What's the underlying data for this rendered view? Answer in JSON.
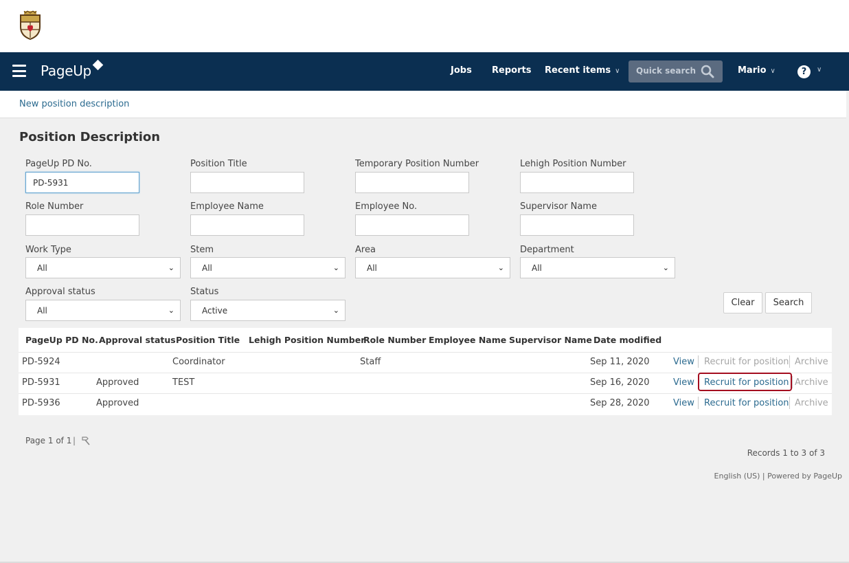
{
  "header": {
    "brand": "PageUp",
    "nav": {
      "jobs": "Jobs",
      "reports": "Reports",
      "recent_items": "Recent items",
      "quick_search_placeholder": "Quick search",
      "user": "Mario",
      "help": "?"
    }
  },
  "subnav": {
    "new_link": "New position description"
  },
  "page_title": "Position Description",
  "search_form": {
    "pd_no": {
      "label": "PageUp PD No.",
      "value": "PD-5931"
    },
    "position_title": {
      "label": "Position Title",
      "value": ""
    },
    "temp_position_number": {
      "label": "Temporary Position Number",
      "value": ""
    },
    "lehigh_position_number": {
      "label": "Lehigh Position Number",
      "value": ""
    },
    "role_number": {
      "label": "Role Number",
      "value": ""
    },
    "employee_name": {
      "label": "Employee Name",
      "value": ""
    },
    "employee_no": {
      "label": "Employee No.",
      "value": ""
    },
    "supervisor_name": {
      "label": "Supervisor Name",
      "value": ""
    },
    "work_type": {
      "label": "Work Type",
      "value": "All"
    },
    "stem": {
      "label": "Stem",
      "value": "All"
    },
    "area": {
      "label": "Area",
      "value": "All"
    },
    "department": {
      "label": "Department",
      "value": "All"
    },
    "approval_status": {
      "label": "Approval status",
      "value": "All"
    },
    "status": {
      "label": "Status",
      "value": "Active"
    },
    "clear_label": "Clear",
    "search_label": "Search"
  },
  "table": {
    "columns": [
      "PageUp PD No.",
      "Approval status",
      "Position Title",
      "Lehigh Position Number",
      "Role Number",
      "Employee Name",
      "Supervisor Name",
      "Date modified"
    ],
    "actions": {
      "view": "View",
      "recruit": "Recruit for position",
      "archive": "Archive"
    },
    "rows": [
      {
        "pd_no": "PD-5924",
        "approval": "",
        "title": "Coordinator",
        "lehigh": "",
        "role": "Staff",
        "employee": "",
        "supervisor": "",
        "date": "Sep 11, 2020"
      },
      {
        "pd_no": "PD-5931",
        "approval": "Approved",
        "title": "TEST",
        "lehigh": "",
        "role": "",
        "employee": "",
        "supervisor": "",
        "date": "Sep 16, 2020"
      },
      {
        "pd_no": "PD-5936",
        "approval": "Approved",
        "title": "",
        "lehigh": "",
        "role": "",
        "employee": "",
        "supervisor": "",
        "date": "Sep 28, 2020"
      }
    ]
  },
  "pagination": {
    "page_text": "Page 1 of 1",
    "separator": "|",
    "records": "Records 1 to 3 of 3"
  },
  "footer": {
    "text": "English (US) | Powered by PageUp"
  },
  "colors": {
    "navbar": "#0b2f51",
    "link": "#2b6a8f",
    "highlight": "#a40d1f"
  },
  "icons": [
    "menu-icon",
    "search-icon",
    "chevron-down-icon",
    "help-icon",
    "hammer-icon",
    "crest-logo"
  ]
}
